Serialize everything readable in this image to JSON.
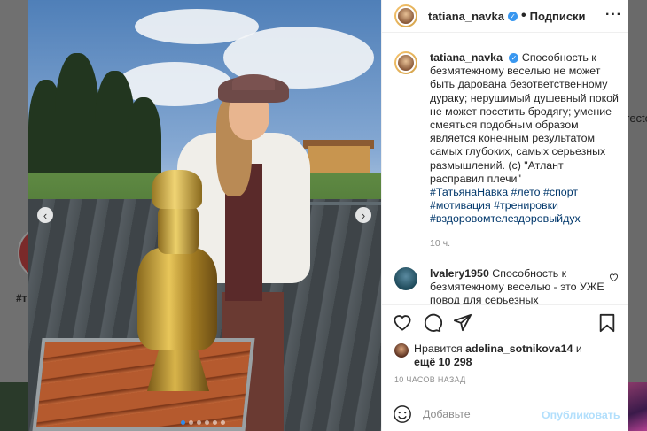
{
  "background": {
    "left_fragment": "#т",
    "right_fragment": "recto"
  },
  "post": {
    "author": {
      "username": "tatiana_navka",
      "verified": true,
      "follow_label": "Подписки",
      "more_icon": "ellipsis-icon"
    },
    "caption": {
      "username": "tatiana_navka",
      "text": "Способность к безмятежному веселью не может быть дарована безответственному дураку; нерушимый душевный покой не может посетить бродягу; умение смеяться подобным образом является конечным результатом самых глубоких, самых серьезных размышлений. (с) \"Атлант расправил плечи\"",
      "hashtags": "#ТатьянаНавка #лето #спорт #мотивация #тренировки #вздоровомтелездоровыйдух",
      "time_ago": "10 ч."
    },
    "comments": [
      {
        "username": "lvalery1950",
        "text": "Способность к безмятежному веселью - это УЖЕ повод для серьезных"
      }
    ],
    "likes": {
      "prefix": "Нравится",
      "user": "adelina_sotnikova14",
      "conj": "и",
      "more_label": "ещё 10 298"
    },
    "date": "10 ЧАСОВ НАЗАД",
    "comment_input": {
      "placeholder": "Добавьте",
      "publish_label": "Опубликовать"
    },
    "carousel": {
      "total": 6,
      "active": 0
    },
    "colors": {
      "link": "#00376b",
      "verified": "#3897f0",
      "publish_disabled": "#b2dffc",
      "active_dot": "#2d8cf0"
    }
  }
}
